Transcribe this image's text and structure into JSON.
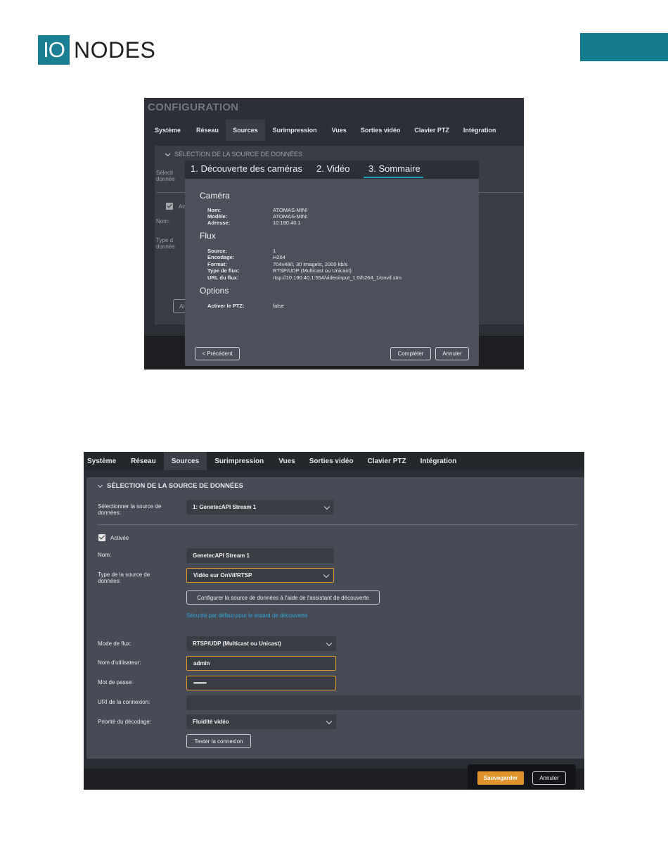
{
  "brand": {
    "logo_box": "IO",
    "logo_text": "NODES",
    "accent": "#157b8e"
  },
  "config": {
    "title": "CONFIGURATION",
    "tabs": [
      "Système",
      "Réseau",
      "Sources",
      "Surimpression",
      "Vues",
      "Sorties vidéo",
      "Clavier PTZ",
      "Intégration"
    ],
    "active_tab": "Sources",
    "bg_section": "SÉLECTION DE LA SOURCE DE DONNÉES",
    "bg_label_1": "Sélecti",
    "bg_label_1b": "donnée",
    "bg_check": "Ac",
    "bg_label_2": "Nom:",
    "bg_label_3": "Type d",
    "bg_label_3b": "donnée",
    "bg_btn": "Ai"
  },
  "wizard": {
    "steps": [
      "1. Découverte des caméras",
      "2. Vidéo",
      "3. Sommaire"
    ],
    "active_step": "3. Sommaire",
    "camera_title": "Caméra",
    "camera": [
      {
        "key": "Nom:",
        "value": "ATOMAS-MINI"
      },
      {
        "key": "Modèle:",
        "value": "ATOMAS-MINI"
      },
      {
        "key": "Adresse:",
        "value": "10.190.40.1"
      }
    ],
    "flux_title": "Flux",
    "flux": [
      {
        "key": "Source:",
        "value": "1"
      },
      {
        "key": "Encodage:",
        "value": "H264"
      },
      {
        "key": "Format:",
        "value": "704x480, 30 image/s, 2000 kb/s"
      },
      {
        "key": "Type de flux:",
        "value": "RTSP/UDP (Multicast ou Unicast)"
      },
      {
        "key": "URL du flux:",
        "value": "rtsp://10.190.40.1:554/videoinput_1:0/h264_1/onvif.stm"
      }
    ],
    "options_title": "Options",
    "options": [
      {
        "key": "Activer le PTZ:",
        "value": "false"
      }
    ],
    "prev_button": "< Précédent",
    "complete_button": "Compléter",
    "cancel_button": "Annuler"
  },
  "sources": {
    "tabs": [
      "Système",
      "Réseau",
      "Sources",
      "Surimpression",
      "Vues",
      "Sorties vidéo",
      "Clavier PTZ",
      "Intégration"
    ],
    "active_tab": "Sources",
    "section_title": "SÉLECTION DE LA SOURCE DE DONNÉES",
    "select_source_label": "Sélectionner la source de données:",
    "select_source_value": "1: GenetecAPI Stream 1",
    "enabled_label": "Activée",
    "name_label": "Nom:",
    "name_value": "GenetecAPI Stream 1",
    "source_type_label": "Type de la source de données:",
    "source_type_value": "Vidéo sur OnVif/RTSP",
    "wizard_button": "Configurer la source de données à l'aide de l'assistant de découverte",
    "security_link": "Sécurité par défaut pour le wizard de découverte",
    "stream_mode_label": "Mode de flux:",
    "stream_mode_value": "RTSP/UDP (Multicast ou Unicast)",
    "username_label": "Nom d'utilisateur:",
    "username_value": "admin",
    "password_label": "Mot de passe:",
    "password_value": "••••••••••",
    "uri_label": "URI de la connexion:",
    "uri_value": "",
    "decode_priority_label": "Priorité du décodage:",
    "decode_priority_value": "Fluidité vidéo",
    "test_button": "Tester la connexion",
    "save_button": "Sauvegarder",
    "cancel_button": "Annuler"
  }
}
